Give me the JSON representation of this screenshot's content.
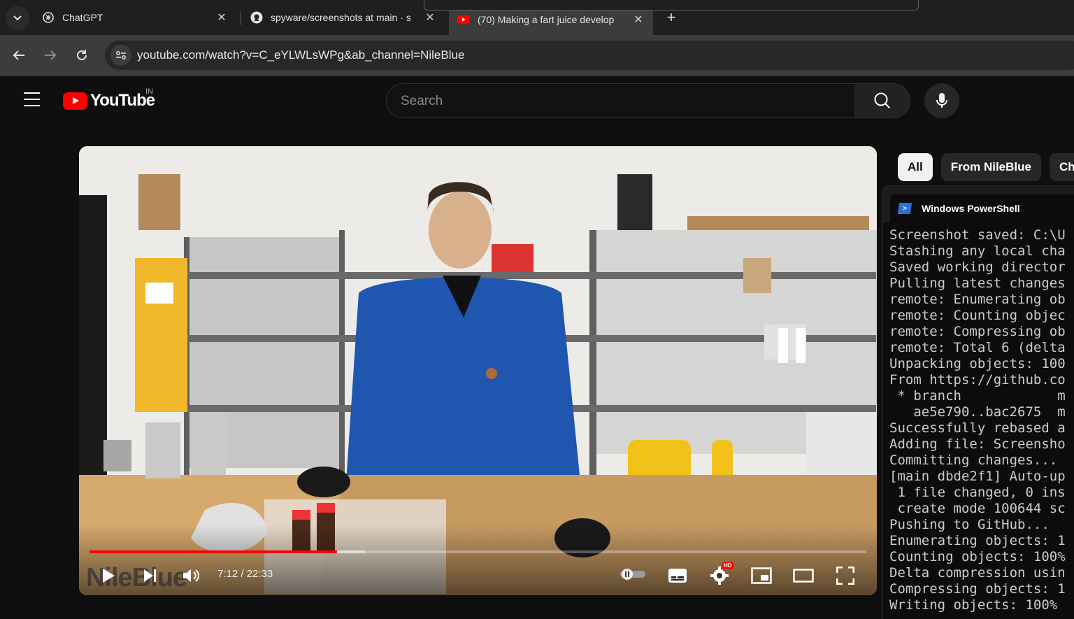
{
  "browser": {
    "tabs": [
      {
        "title": "ChatGPT",
        "icon": "chatgpt-icon",
        "active": false
      },
      {
        "title": "spyware/screenshots at main · s",
        "icon": "github-icon",
        "active": false
      },
      {
        "title": "(70) Making a fart juice develop",
        "icon": "youtube-icon",
        "active": true
      }
    ],
    "url": "youtube.com/watch?v=C_eYLWLsWPg&ab_channel=NileBlue"
  },
  "youtube": {
    "logo_text": "YouTube",
    "country_code": "IN",
    "search_placeholder": "Search",
    "player": {
      "current_time": "7:12",
      "duration": "22:33",
      "time_display": "7:12 / 22:33",
      "progress_played": 0.319,
      "progress_buffered": 0.355,
      "hd_badge": "HD",
      "watermark": "NileBlue"
    },
    "chips": [
      "All",
      "From NileBlue",
      "Che"
    ]
  },
  "powershell": {
    "title": "Windows PowerShell",
    "lines": [
      "Screenshot saved: C:\\U",
      "Stashing any local cha",
      "Saved working director",
      "Pulling latest changes",
      "remote: Enumerating ob",
      "remote: Counting objec",
      "remote: Compressing ob",
      "remote: Total 6 (delta",
      "Unpacking objects: 100",
      "From https://github.co",
      " * branch            m",
      "   ae5e790..bac2675  m",
      "Successfully rebased a",
      "Adding file: Screensho",
      "Committing changes...",
      "[main dbde2f1] Auto-up",
      " 1 file changed, 0 ins",
      " create mode 100644 sc",
      "Pushing to GitHub...",
      "Enumerating objects: 1",
      "Counting objects: 100%",
      "Delta compression usin",
      "Compressing objects: 1",
      "Writing objects: 100%"
    ]
  },
  "colors": {
    "yt_red": "#ff0000",
    "ps_blue": "#2f6fd6",
    "bg": "#0f0f0f"
  }
}
